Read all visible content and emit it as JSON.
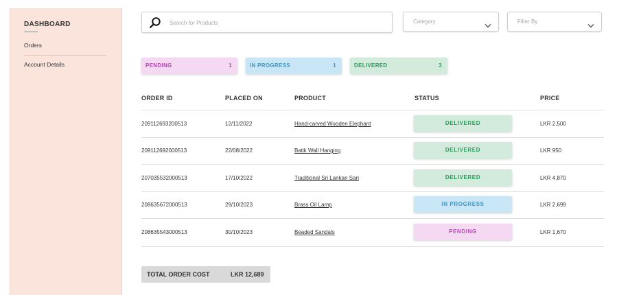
{
  "sidebar": {
    "title": "DASHBOARD",
    "items": [
      {
        "label": "Orders"
      },
      {
        "label": "Account Details"
      }
    ]
  },
  "search": {
    "placeholder": "Search for Products",
    "value": ""
  },
  "filters": {
    "category": {
      "label": "Category"
    },
    "filter_by": {
      "label": "Filter By"
    }
  },
  "status_summary": [
    {
      "label": "PENDING",
      "count": "1",
      "bg": "#f5d9f3",
      "fg": "#b049b0"
    },
    {
      "label": "IN PROGRESS",
      "count": "1",
      "bg": "#c9e6f7",
      "fg": "#3f95c4"
    },
    {
      "label": "DELIVERED",
      "count": "3",
      "bg": "#d2ebdc",
      "fg": "#2f9a5b"
    }
  ],
  "table": {
    "headers": [
      "ORDER ID",
      "PLACED ON",
      "PRODUCT",
      "STATUS",
      "PRICE"
    ],
    "rows": [
      {
        "order_id": "209112693200513",
        "placed_on": "12/11/2022",
        "product": "Hand-carved Wooden Elephant",
        "status": "DELIVERED",
        "price": "LKR 2,500"
      },
      {
        "order_id": "209112692000513",
        "placed_on": "22/08/2022",
        "product": "Batik Wall Hanging",
        "status": "DELIVERED",
        "price": "LKR 950"
      },
      {
        "order_id": "207035532000513",
        "placed_on": "17/10/2022",
        "product": "Traditional Sri Lankan Sari",
        "status": "DELIVERED",
        "price": "LKR 4,870"
      },
      {
        "order_id": "208635672000513",
        "placed_on": "29/10/2023",
        "product": "Brass Oil Lamp",
        "status": "IN PROGRESS",
        "price": "LKR 2,699"
      },
      {
        "order_id": "208635543000513",
        "placed_on": "30/10/2023",
        "product": "Beaded Sandals",
        "status": "PENDING",
        "price": "LKR 1,670"
      }
    ]
  },
  "total": {
    "label": "TOTAL ORDER COST",
    "value": "LKR 12,689"
  },
  "icons": {
    "search": "search-icon",
    "chevron": "chevron-down-icon"
  },
  "colors": {
    "sidebar_bg": "#fae4dc",
    "pending_bg": "#f5d9f3",
    "pending_fg": "#b049b0",
    "progress_bg": "#c9e6f7",
    "progress_fg": "#3f95c4",
    "delivered_bg": "#d2ebdc",
    "delivered_fg": "#2f9a5b",
    "total_bg": "#d9d9d9"
  }
}
